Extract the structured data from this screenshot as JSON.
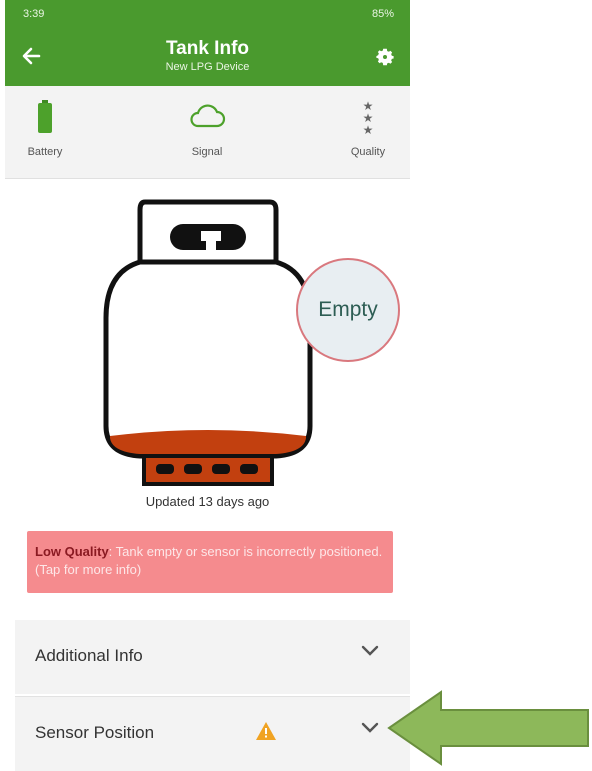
{
  "status_bar": {
    "time": "3:39",
    "battery_text": "85%"
  },
  "header": {
    "title": "Tank Info",
    "subtitle": "New LPG Device"
  },
  "metrics": [
    {
      "label": "Battery",
      "icon": "battery-icon"
    },
    {
      "label": "Signal",
      "icon": "cloud-icon"
    },
    {
      "label": "Quality",
      "icon": "stars-icon"
    }
  ],
  "tank": {
    "level_text": "Empty",
    "updated": "Updated 13 days ago",
    "fill_color": "#c2400f"
  },
  "alert": {
    "title": "Low Quality",
    "message": ": Tank empty or sensor is incorrectly positioned. (Tap for more info)"
  },
  "sections": [
    {
      "label": "Additional Info"
    },
    {
      "label": "Sensor Position"
    }
  ],
  "colors": {
    "appbar": "#4a9a2e",
    "alert": "#f58b8e",
    "callout_arrow": "#8db85a"
  }
}
